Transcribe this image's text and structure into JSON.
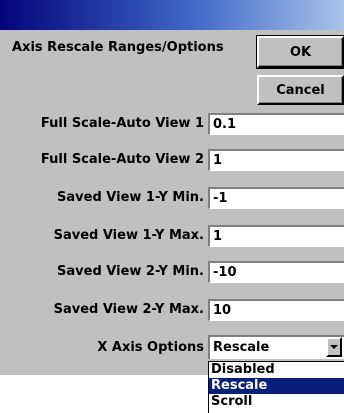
{
  "dialog": {
    "heading": "Axis Rescale Ranges/Options",
    "ok_label": "OK",
    "cancel_label": "Cancel"
  },
  "fields": [
    {
      "label": "Full Scale-Auto View 1",
      "value": "0.1"
    },
    {
      "label": "Full Scale-Auto View 2",
      "value": "1"
    },
    {
      "label": "Saved View 1-Y Min.",
      "value": "-1"
    },
    {
      "label": "Saved View 1-Y Max.",
      "value": "1"
    },
    {
      "label": "Saved View 2-Y Min.",
      "value": "-10"
    },
    {
      "label": "Saved View 2-Y Max.",
      "value": "10"
    }
  ],
  "x_axis": {
    "label": "X Axis Options",
    "value": "Rescale",
    "options": [
      "Disabled",
      "Rescale",
      "Scroll"
    ],
    "highlighted": "Rescale"
  },
  "colors": {
    "title_bar": "#04047a",
    "highlight": "#0a1f7a",
    "face": "#c0c0c0"
  }
}
